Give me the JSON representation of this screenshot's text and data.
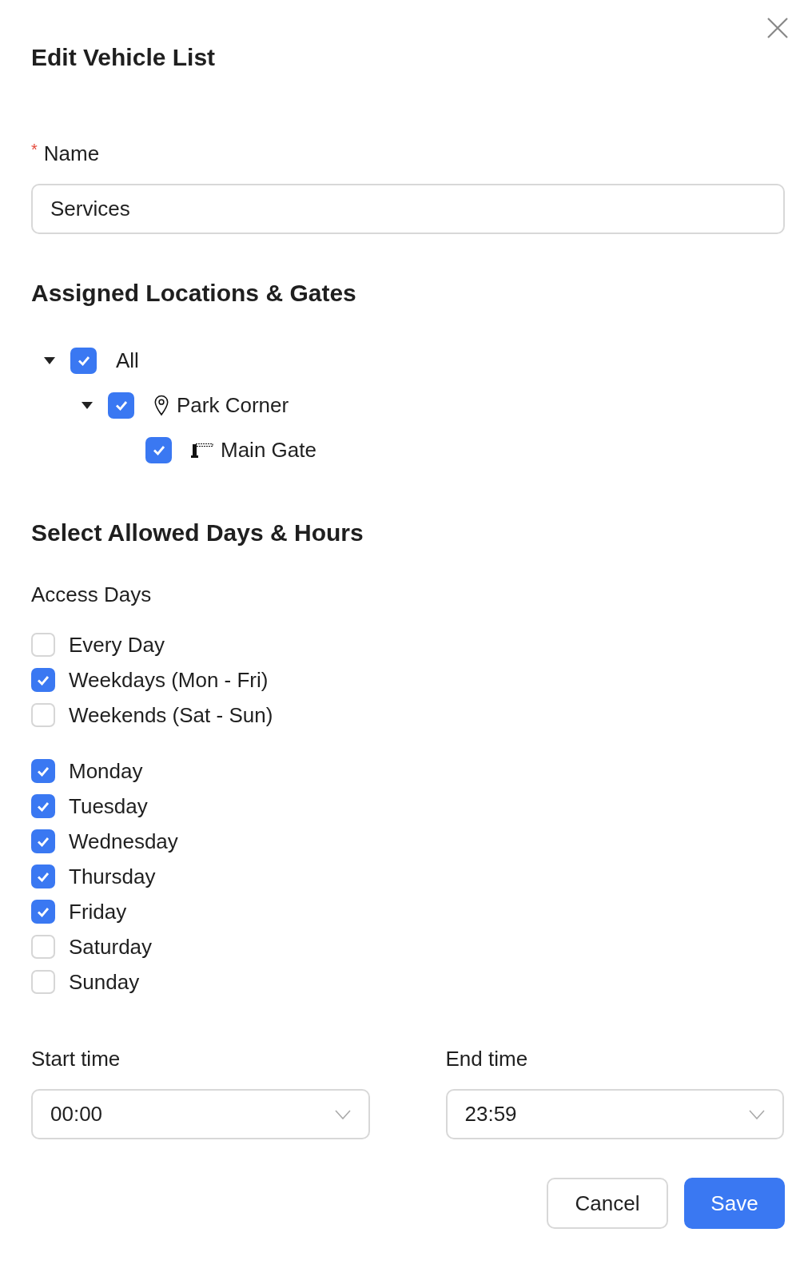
{
  "dialog": {
    "title": "Edit Vehicle List"
  },
  "name_field": {
    "required_mark": "*",
    "label": "Name",
    "value": "Services"
  },
  "locations": {
    "heading": "Assigned Locations & Gates",
    "tree": [
      {
        "label": "All",
        "checked": true,
        "expanded": true,
        "children": [
          {
            "label": "Park Corner",
            "kind": "location",
            "checked": true,
            "expanded": true,
            "children": [
              {
                "label": "Main Gate",
                "kind": "gate",
                "checked": true
              }
            ]
          }
        ]
      }
    ]
  },
  "schedule": {
    "heading": "Select Allowed Days & Hours",
    "days_label": "Access Days",
    "presets": [
      {
        "label": "Every Day",
        "checked": false
      },
      {
        "label": "Weekdays (Mon - Fri)",
        "checked": true
      },
      {
        "label": "Weekends (Sat - Sun)",
        "checked": false
      }
    ],
    "days": [
      {
        "label": "Monday",
        "checked": true
      },
      {
        "label": "Tuesday",
        "checked": true
      },
      {
        "label": "Wednesday",
        "checked": true
      },
      {
        "label": "Thursday",
        "checked": true
      },
      {
        "label": "Friday",
        "checked": true
      },
      {
        "label": "Saturday",
        "checked": false
      },
      {
        "label": "Sunday",
        "checked": false
      }
    ],
    "start": {
      "label": "Start time",
      "value": "00:00"
    },
    "end": {
      "label": "End time",
      "value": "23:59"
    }
  },
  "buttons": [
    {
      "label": "Cancel",
      "kind": "secondary"
    },
    {
      "label": "Save",
      "kind": "primary"
    }
  ]
}
